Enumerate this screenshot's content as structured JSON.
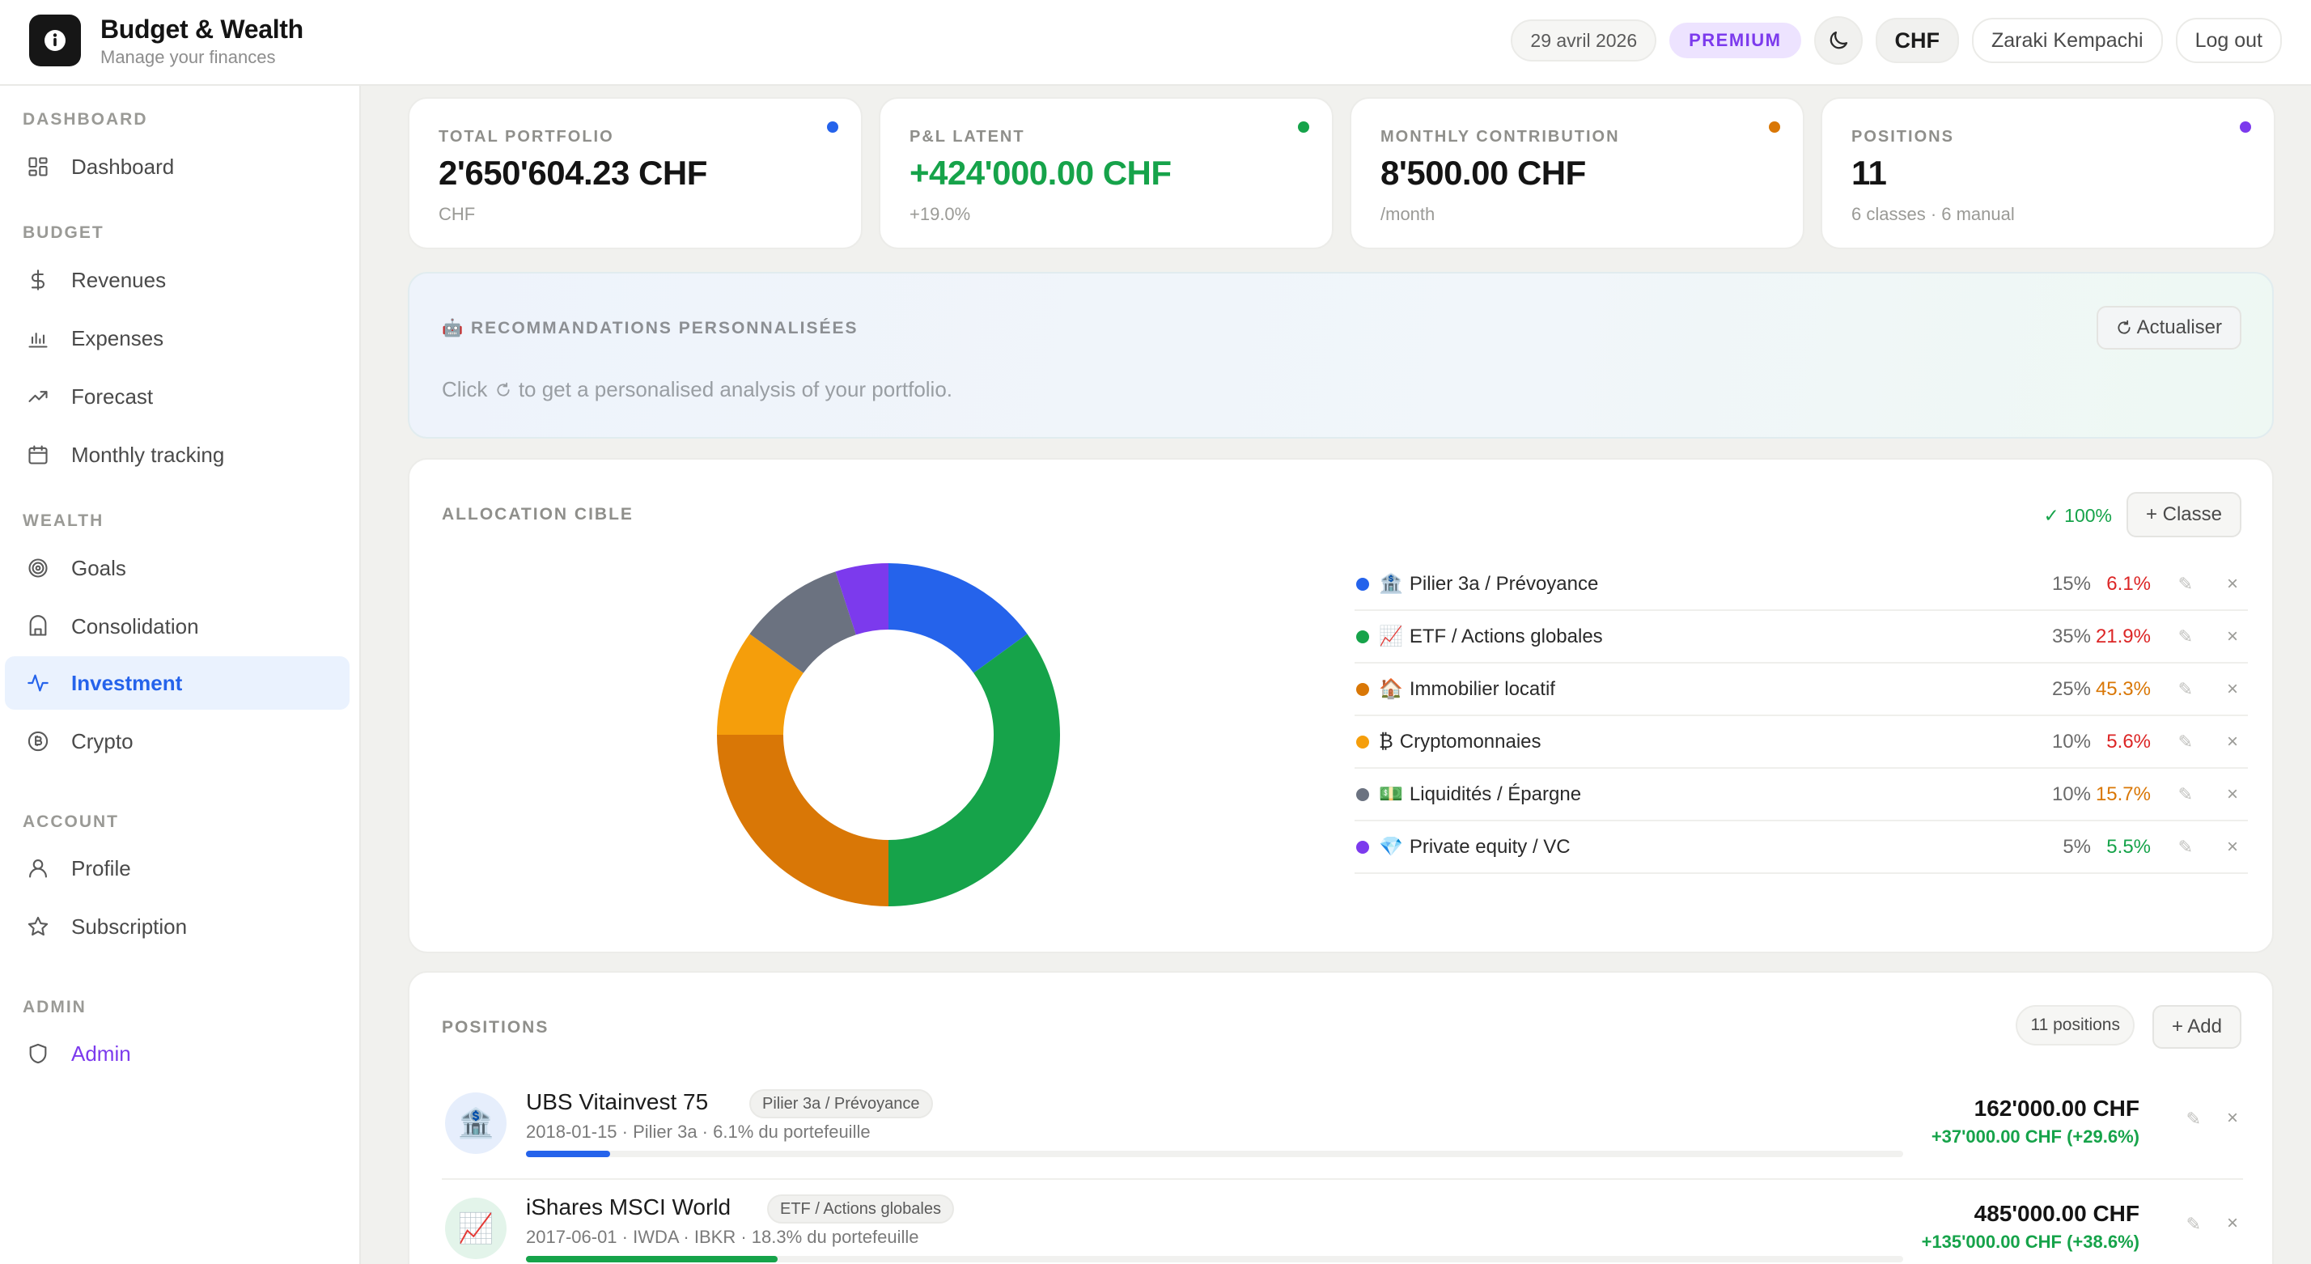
{
  "app": {
    "title": "Budget & Wealth",
    "subtitle": "Manage your finances"
  },
  "header": {
    "date": "29 avril 2026",
    "premium": "PREMIUM",
    "currency": "CHF",
    "user": "Zaraki Kempachi",
    "logout": "Log out"
  },
  "sidebar": {
    "sections": [
      {
        "label": "DASHBOARD"
      },
      {
        "label": "BUDGET"
      },
      {
        "label": "WEALTH"
      },
      {
        "label": "ACCOUNT"
      },
      {
        "label": "ADMIN"
      }
    ],
    "items": [
      {
        "label": "Dashboard",
        "icon": "dashboard-grid-icon"
      },
      {
        "label": "Revenues",
        "icon": "dollar-icon"
      },
      {
        "label": "Expenses",
        "icon": "bar-chart-icon"
      },
      {
        "label": "Forecast",
        "icon": "trending-up-icon"
      },
      {
        "label": "Monthly tracking",
        "icon": "calendar-icon"
      },
      {
        "label": "Goals",
        "icon": "target-icon"
      },
      {
        "label": "Consolidation",
        "icon": "bank-icon"
      },
      {
        "label": "Investment",
        "icon": "activity-icon",
        "active": true
      },
      {
        "label": "Crypto",
        "icon": "bitcoin-icon"
      },
      {
        "label": "Profile",
        "icon": "user-icon"
      },
      {
        "label": "Subscription",
        "icon": "star-icon"
      },
      {
        "label": "Admin",
        "icon": "shield-icon"
      }
    ]
  },
  "stats": [
    {
      "label": "TOTAL PORTFOLIO",
      "value": "2'650'604.23 CHF",
      "sub": "CHF",
      "color": "#2563eb",
      "value_color": "#141414"
    },
    {
      "label": "P&L LATENT",
      "value": "+424'000.00 CHF",
      "sub": "+19.0%",
      "color": "#16a34a",
      "value_color": "#16a34a"
    },
    {
      "label": "MONTHLY CONTRIBUTION",
      "value": "8'500.00 CHF",
      "sub": "/month",
      "color": "#d97706",
      "value_color": "#141414"
    },
    {
      "label": "POSITIONS",
      "value": "11",
      "sub": "6 classes · 6 manual",
      "color": "#7c3aed",
      "value_color": "#141414"
    }
  ],
  "reco": {
    "icon": "🤖",
    "title": "RECOMMANDATIONS PERSONNALISÉES",
    "refresh": "Actualiser",
    "msg_before": "Click",
    "msg_after": "to get a personalised analysis of your portfolio."
  },
  "allocation": {
    "title": "ALLOCATION CIBLE",
    "total": "✓ 100%",
    "add": "+ Classe",
    "classes": [
      {
        "emoji": "🏦",
        "name": "Pilier 3a / Prévoyance",
        "target": "15%",
        "actual": "6.1%",
        "actual_color": "#dc2626",
        "color": "#2563eb"
      },
      {
        "emoji": "📈",
        "name": "ETF / Actions globales",
        "target": "35%",
        "actual": "21.9%",
        "actual_color": "#dc2626",
        "color": "#16a34a"
      },
      {
        "emoji": "🏠",
        "name": "Immobilier locatif",
        "target": "25%",
        "actual": "45.3%",
        "actual_color": "#d97706",
        "color": "#d97706"
      },
      {
        "emoji": "₿",
        "name": "Cryptomonnaies",
        "target": "10%",
        "actual": "5.6%",
        "actual_color": "#dc2626",
        "color": "#f59e0b"
      },
      {
        "emoji": "💵",
        "name": "Liquidités / Épargne",
        "target": "10%",
        "actual": "15.7%",
        "actual_color": "#d97706",
        "color": "#6b7280"
      },
      {
        "emoji": "💎",
        "name": "Private equity / VC",
        "target": "5%",
        "actual": "5.5%",
        "actual_color": "#16a34a",
        "color": "#7c3aed"
      }
    ]
  },
  "chart_data": {
    "type": "pie",
    "donut": true,
    "categories": [
      "Pilier 3a / Prévoyance",
      "ETF / Actions globales",
      "Immobilier locatif",
      "Cryptomonnaies",
      "Liquidités / Épargne",
      "Private equity / VC"
    ],
    "values": [
      15,
      35,
      25,
      10,
      10,
      5
    ],
    "colors": [
      "#2563eb",
      "#16a34a",
      "#d97706",
      "#f59e0b",
      "#6b7280",
      "#7c3aed"
    ]
  },
  "positions": {
    "title": "POSITIONS",
    "count": "11 positions",
    "add": "+ Add",
    "items": [
      {
        "emoji": "🏦",
        "name": "UBS Vitainvest 75",
        "tag": "Pilier 3a / Prévoyance",
        "meta": "2018-01-15 · Pilier 3a · 6.1% du portefeuille",
        "value": "162'000.00 CHF",
        "gain": "+37'000.00 CHF (+29.6%)",
        "share": 0.061,
        "color": "#2563eb",
        "avatar_bg": "#e6eefc"
      },
      {
        "emoji": "📈",
        "name": "iShares MSCI World",
        "tag": "ETF / Actions globales",
        "meta": "2017-06-01 · IWDA · IBKR · 18.3% du portefeuille",
        "value": "485'000.00 CHF",
        "gain": "+135'000.00 CHF (+38.6%)",
        "share": 0.183,
        "color": "#16a34a",
        "avatar_bg": "#e3f4ea"
      }
    ]
  }
}
